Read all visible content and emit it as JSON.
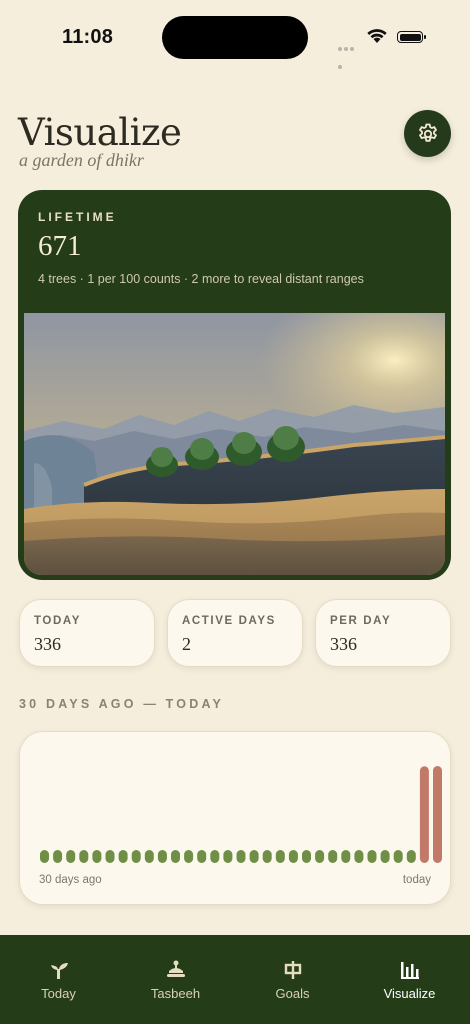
{
  "status_bar": {
    "time": "11:08"
  },
  "header": {
    "title": "Visualize",
    "subtitle": "a garden of dhikr",
    "settings_icon": "gear-icon"
  },
  "lifetime": {
    "label": "LIFETIME",
    "value": "671",
    "caption": "4 trees · 1 per 100 counts · 2 more to reveal distant ranges",
    "trees_shown": 4
  },
  "stats": [
    {
      "label": "TODAY",
      "value": "336"
    },
    {
      "label": "ACTIVE DAYS",
      "value": "2"
    },
    {
      "label": "PER DAY",
      "value": "336"
    }
  ],
  "history": {
    "title": "30 DAYS AGO — TODAY",
    "start_label": "30 days ago",
    "end_label": "today",
    "days": [
      0,
      0,
      0,
      0,
      0,
      0,
      0,
      0,
      0,
      0,
      0,
      0,
      0,
      0,
      0,
      0,
      0,
      0,
      0,
      0,
      0,
      0,
      0,
      0,
      0,
      0,
      0,
      0,
      0,
      335,
      336
    ],
    "colors": {
      "empty": "#6e8f45",
      "active": "#c27a68"
    }
  },
  "tabs": [
    {
      "label": "Today",
      "icon": "sprout-icon"
    },
    {
      "label": "Tasbeeh",
      "icon": "beads-icon"
    },
    {
      "label": "Goals",
      "icon": "goal-icon"
    },
    {
      "label": "Visualize",
      "icon": "bar-chart-icon",
      "active": true
    }
  ],
  "colors": {
    "accent": "#243d18",
    "background": "#f5eedd",
    "card": "#fcf8ee"
  }
}
